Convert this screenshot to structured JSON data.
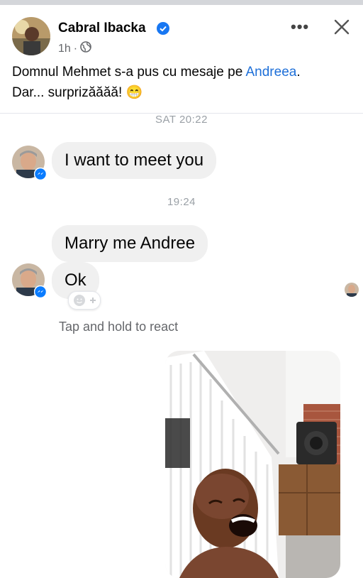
{
  "post": {
    "author": "Cabral Ibacka",
    "time": "1h",
    "dot": "·",
    "caption_start": "Domnul Mehmet s-a pus cu mesaje pe ",
    "caption_link": "Andreea",
    "caption_end": ".",
    "caption_line2": "Dar... surprizăăăă! 😁",
    "icons": {
      "more": "more-horizontal-icon",
      "close": "close-icon",
      "audience": "globe-icon",
      "verified": "verified-badge-icon"
    }
  },
  "chat": {
    "timestamp_1": "SAT 20:22",
    "message_1": "I want to meet you",
    "timestamp_2": "19:24",
    "message_2": "Marry me Andree",
    "message_3": "Ok",
    "react_hint": "Tap and hold to react"
  },
  "colors": {
    "link": "#1d6fd8",
    "bubble": "#f0f0f0",
    "verified": "#1877f2",
    "messenger": "#0a7cff"
  }
}
